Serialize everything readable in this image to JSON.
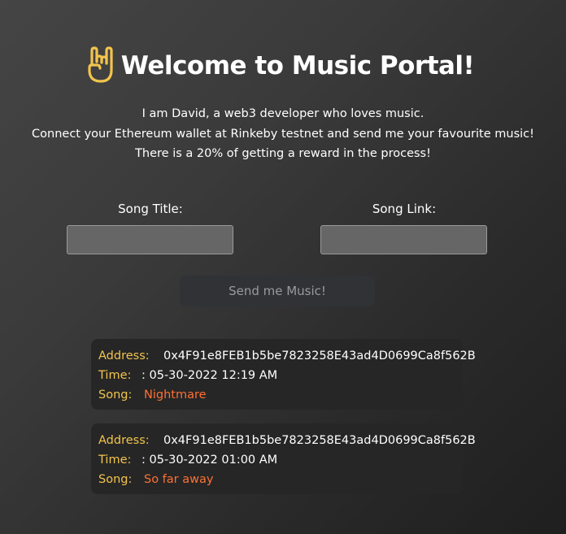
{
  "header": {
    "icon": "rock-hand-icon",
    "title": "Welcome to Music Portal!",
    "accent_color": "#f2c44d"
  },
  "bio": {
    "line1": "I am David, a web3 developer who loves music.",
    "line2": "Connect your Ethereum wallet at Rinkeby testnet and send me your favourite music!",
    "line3": "There is a 20% of getting a reward in the process!"
  },
  "form": {
    "song_title_label": "Song Title:",
    "song_title_value": "",
    "song_link_label": "Song Link:",
    "song_link_value": "",
    "send_label": "Send me Music!"
  },
  "messages": [
    {
      "address_label": "Address:",
      "address": "0x4F91e8FEB1b5be7823258E43ad4D0699Ca8f562B",
      "time_label": "Time:",
      "time": ": 05-30-2022 12:19 AM",
      "song_label": "Song:",
      "song": "Nightmare"
    },
    {
      "address_label": "Address:",
      "address": "0x4F91e8FEB1b5be7823258E43ad4D0699Ca8f562B",
      "time_label": "Time:",
      "time": ": 05-30-2022 01:00 AM",
      "song_label": "Song:",
      "song": "So far away"
    }
  ],
  "colors": {
    "key": "#f2c44d",
    "song": "#ff7033",
    "card_bg": "#262626",
    "button_bg": "#303236"
  }
}
